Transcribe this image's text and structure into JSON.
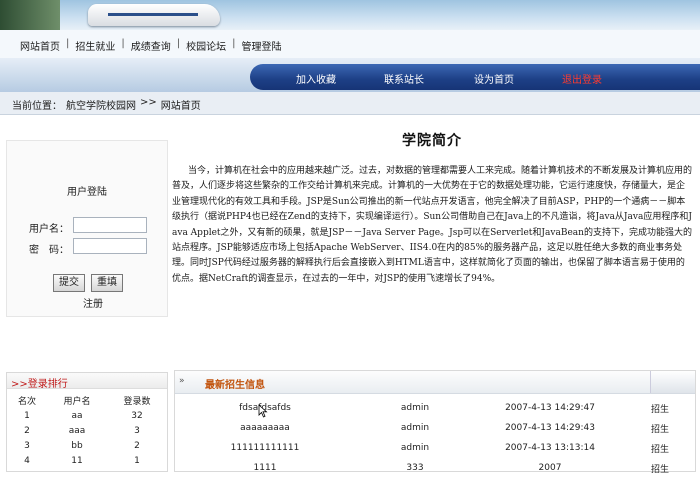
{
  "top_nav": {
    "links": [
      "网站首页",
      "招生就业",
      "成绩查询",
      "校园论坛",
      "管理登陆"
    ]
  },
  "action_bar": {
    "items": [
      {
        "label": "加入收藏"
      },
      {
        "label": "联系站长"
      },
      {
        "label": "设为首页"
      },
      {
        "label": "退出登录"
      }
    ]
  },
  "breadcrumb": {
    "prefix": "当前位置：",
    "site": "航空学院校园网",
    "sep": ">>",
    "current": "网站首页"
  },
  "login": {
    "title": "用户登陆",
    "username_label": "用户名：",
    "password_label": "密　码：",
    "username_value": "",
    "password_value": "",
    "submit_label": "提交",
    "reset_label": "重填",
    "register_label": "注册"
  },
  "article": {
    "title": "学院简介",
    "body": "当今，计算机在社会中的应用越来越广泛。过去，对数据的管理都需要人工来完成。随着计算机技术的不断发展及计算机应用的普及，人们逐步将这些繁杂的工作交给计算机来完成。计算机的一大优势在于它的数据处理功能，它运行速度快，存储量大，是企业管理现代化的有效工具和手段。JSP是Sun公司推出的新一代站点开发语言，他完全解决了目前ASP，PHP的一个通病－－脚本级执行（据说PHP4也已经在Zend的支持下，实现编译运行）。Sun公司借助自己在Java上的不凡造诣，将Java从Java应用程序和Java Applet之外，又有新的硕果，就是JSP－－Java Server Page。Jsp可以在Serverlet和JavaBean的支持下，完成功能强大的站点程序。JSP能够适应市场上包括Apache WebServer、IIS4.0在内的85%的服务器产品，这足以胜任绝大多数的商业事务处理。同时JSP代码经过服务器的解释执行后会直接嵌入到HTML语言中，这样就简化了页面的输出，也保留了脚本语言易于使用的优点。据NetCraft的调查显示，在过去的一年中，对JSP的使用飞速增长了94%。"
  },
  "ranking": {
    "title": ">>登录排行",
    "headers": [
      "名次",
      "用户名",
      "登录数"
    ],
    "rows": [
      [
        "1",
        "aa",
        "32"
      ],
      [
        "2",
        "aaa",
        "3"
      ],
      [
        "3",
        "bb",
        "2"
      ],
      [
        "4",
        "11",
        "1"
      ]
    ]
  },
  "news": {
    "title": "最新招生信息",
    "rows": [
      [
        "fdsafdsafds",
        "admin",
        "2007-4-13 14:29:47",
        "招生"
      ],
      [
        "aaaaaaaaa",
        "admin",
        "2007-4-13 14:29:43",
        "招生"
      ],
      [
        "111111111111",
        "admin",
        "2007-4-13 13:13:14",
        "招生"
      ],
      [
        "1111",
        "333",
        "2007",
        "招生"
      ]
    ]
  },
  "colors": {
    "action_bar_blue": "#1d3f86",
    "logout_red": "#ff3b2e",
    "news_title_orange": "#c2530d",
    "ranking_title_red": "#c01a1a"
  }
}
